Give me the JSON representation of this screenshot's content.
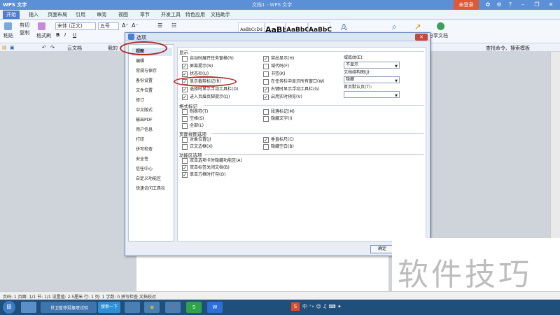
{
  "app": {
    "title": "WPS 文字",
    "document_title": "文档1 - WPS 文字",
    "login_label": "未登录"
  },
  "ribbon_tabs": [
    "开始",
    "插入",
    "页面布局",
    "引用",
    "审阅",
    "视图",
    "章节",
    "开发工具",
    "特色应用",
    "文档助手"
  ],
  "ribbon": {
    "paste": "粘贴",
    "cut": "剪切",
    "copy": "复制",
    "format_painter": "格式刷",
    "font_name": "宋体 (正文)",
    "font_size": "五号",
    "style_samples": [
      "AaBbCcDd",
      "AaBb",
      "AaBbC",
      "AaBbC"
    ],
    "share": "分享文档",
    "search": "查找命令、搜索模板"
  },
  "doc_tabs": [
    "云文档",
    "我的"
  ],
  "dialog": {
    "title": "选项",
    "ok_label": "确定",
    "nav_items": [
      "视图",
      "编辑",
      "常规与保存",
      "备份设置",
      "文件位置",
      "修订",
      "中文版式",
      "输出PDF",
      "用户信息",
      "打印",
      "拼写检查",
      "安全性",
      "信任中心",
      "自定义功能区",
      "快速访问工具栏"
    ],
    "sections": {
      "display": "显示",
      "format_marks": "格式标记",
      "page_view": "页面视图选项",
      "ribbon_opts": "功能区选项"
    },
    "display_left": [
      {
        "label": "启动时展开任务窗格(R)",
        "checked": false
      },
      {
        "label": "屏幕提示(N)",
        "checked": true
      },
      {
        "label": "状态栏(U)",
        "checked": true
      },
      {
        "label": "显示裁剪标记(R)",
        "checked": true
      },
      {
        "label": "选择时显示浮动工具栏(D)",
        "checked": true
      },
      {
        "label": "进入页眉页脚提示(Q)",
        "checked": true
      }
    ],
    "display_right": [
      {
        "label": "突出显示(H)",
        "checked": true
      },
      {
        "label": "域代码(F)",
        "checked": false
      },
      {
        "label": "书签(K)",
        "checked": false
      },
      {
        "label": "在任务栏中显示所有窗口(W)",
        "checked": false
      },
      {
        "label": "右键时显示浮动工具栏(G)",
        "checked": true
      },
      {
        "label": "启用实时预览(V)",
        "checked": true
      }
    ],
    "field_shading_label": "域底纹(E):",
    "field_shading_value": "不显示",
    "doc_map_label": "文档结构图(J):",
    "doc_map_value": "隐藏",
    "first_page_label": "首页默认页(T):",
    "first_page_value": "",
    "marks_left": [
      {
        "label": "制表符(T)",
        "checked": false
      },
      {
        "label": "空格(S)",
        "checked": false
      },
      {
        "label": "全部(L)",
        "checked": false
      }
    ],
    "marks_right": [
      {
        "label": "段落标记(M)",
        "checked": false
      },
      {
        "label": "隐藏文字(I)",
        "checked": false
      }
    ],
    "page_left": [
      {
        "label": "对象位置(J)",
        "checked": false
      },
      {
        "label": "正文边框(X)",
        "checked": false
      }
    ],
    "page_right": [
      {
        "label": "垂直标尺(C)",
        "checked": true
      },
      {
        "label": "隐藏空白(B)",
        "checked": false
      }
    ],
    "ribbon_list": [
      {
        "label": "双击选项卡时隐藏功能区(A)",
        "checked": false
      },
      {
        "label": "双击标签关闭文档(B)",
        "checked": true
      },
      {
        "label": "单击方框时打勾(O)",
        "checked": true
      }
    ]
  },
  "statusbar": {
    "text": "页码: 1  页面: 1/1  节: 1/1  设置值: 2.5厘米  行: 1  列: 1  字数: 0  拼写检查  文档校对"
  },
  "taskbar": {
    "active_window": "世卫暂停羟氯喹试验",
    "search_button": "搜索一下"
  },
  "watermark": "软件技巧",
  "colors": {
    "titlebar": "#5b8fd6",
    "highlight_circle": "#b3281f",
    "login": "#e2563a"
  }
}
